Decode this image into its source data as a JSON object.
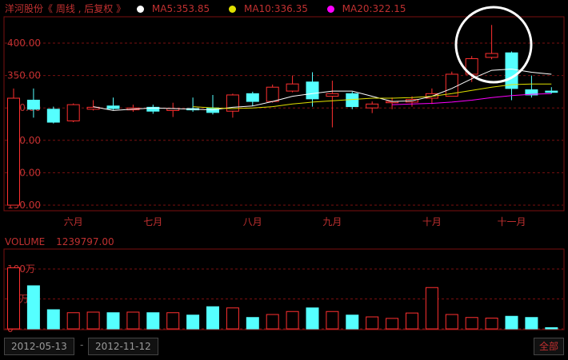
{
  "header": {
    "title": "洋河股份《 周线 , 后复权 》",
    "ma5_label": "MA5:353.85",
    "ma10_label": "MA10:336.35",
    "ma20_label": "MA20:322.15",
    "ma5_color": "#ffffff",
    "ma10_color": "#e0e000",
    "ma20_color": "#ff00ff"
  },
  "price_axis": {
    "labels": [
      "400.00",
      "350.00",
      "300.00",
      "250.00",
      "200.00",
      "150.00"
    ],
    "values": [
      400,
      350,
      300,
      250,
      200,
      150
    ]
  },
  "time_axis": {
    "labels": [
      "六月",
      "七月",
      "八月",
      "九月",
      "十月",
      "十一月"
    ]
  },
  "volume": {
    "label": "VOLUME",
    "value": "1239797.00",
    "axis_labels": [
      "100万",
      "50万",
      "0"
    ]
  },
  "colors": {
    "up": "#ff3030",
    "down": "#55ffff",
    "grid": "#7a1010"
  },
  "chart_data": {
    "type": "candlestick",
    "ylim": [
      150,
      420
    ],
    "candles": [
      {
        "open": 150,
        "close": 315,
        "high": 330,
        "low": 150,
        "volume": 1020000
      },
      {
        "open": 312,
        "close": 298,
        "high": 330,
        "low": 285,
        "volume": 720000
      },
      {
        "open": 298,
        "close": 278,
        "high": 302,
        "low": 276,
        "volume": 320000
      },
      {
        "open": 280,
        "close": 305,
        "high": 307,
        "low": 278,
        "volume": 270000
      },
      {
        "open": 298,
        "close": 301,
        "high": 312,
        "low": 296,
        "volume": 280000
      },
      {
        "open": 303,
        "close": 299,
        "high": 316,
        "low": 297,
        "volume": 270000
      },
      {
        "open": 297,
        "close": 300,
        "high": 305,
        "low": 294,
        "volume": 280000
      },
      {
        "open": 301,
        "close": 295,
        "high": 305,
        "low": 291,
        "volume": 270000
      },
      {
        "open": 296,
        "close": 299,
        "high": 308,
        "low": 286,
        "volume": 270000
      },
      {
        "open": 299,
        "close": 297,
        "high": 316,
        "low": 294,
        "volume": 230000
      },
      {
        "open": 300,
        "close": 293,
        "high": 320,
        "low": 290,
        "volume": 370000
      },
      {
        "open": 295,
        "close": 320,
        "high": 322,
        "low": 285,
        "volume": 350000
      },
      {
        "open": 322,
        "close": 310,
        "high": 325,
        "low": 303,
        "volume": 190000
      },
      {
        "open": 310,
        "close": 332,
        "high": 336,
        "low": 308,
        "volume": 240000
      },
      {
        "open": 326,
        "close": 337,
        "high": 350,
        "low": 324,
        "volume": 290000
      },
      {
        "open": 340,
        "close": 314,
        "high": 355,
        "low": 302,
        "volume": 350000
      },
      {
        "open": 318,
        "close": 322,
        "high": 342,
        "low": 270,
        "volume": 290000
      },
      {
        "open": 322,
        "close": 302,
        "high": 325,
        "low": 298,
        "volume": 230000
      },
      {
        "open": 300,
        "close": 306,
        "high": 310,
        "low": 292,
        "volume": 200000
      },
      {
        "open": 308,
        "close": 310,
        "high": 316,
        "low": 298,
        "volume": 175000
      },
      {
        "open": 309,
        "close": 313,
        "high": 318,
        "low": 302,
        "volume": 265000
      },
      {
        "open": 315,
        "close": 322,
        "high": 330,
        "low": 306,
        "volume": 690000
      },
      {
        "open": 318,
        "close": 352,
        "high": 356,
        "low": 318,
        "volume": 240000
      },
      {
        "open": 352,
        "close": 376,
        "high": 380,
        "low": 340,
        "volume": 190000
      },
      {
        "open": 378,
        "close": 384,
        "high": 428,
        "low": 375,
        "volume": 180000
      },
      {
        "open": 385,
        "close": 330,
        "high": 387,
        "low": 312,
        "volume": 210000
      },
      {
        "open": 328,
        "close": 320,
        "high": 350,
        "low": 316,
        "volume": 190000
      },
      {
        "open": 326,
        "close": 324,
        "high": 332,
        "low": 322,
        "volume": 20000
      }
    ],
    "ma5": [
      null,
      null,
      null,
      null,
      302,
      296,
      298,
      300,
      299,
      298,
      297,
      301,
      303,
      310,
      318,
      322,
      326,
      326,
      318,
      310,
      311,
      318,
      330,
      345,
      358,
      360,
      355,
      352
    ],
    "ma10": [
      null,
      null,
      null,
      null,
      null,
      null,
      null,
      null,
      null,
      302,
      300,
      299,
      300,
      302,
      306,
      309,
      311,
      313,
      315,
      315,
      316,
      318,
      322,
      327,
      332,
      336,
      337,
      337
    ],
    "ma20": [
      null,
      null,
      null,
      null,
      null,
      null,
      null,
      null,
      null,
      null,
      null,
      null,
      null,
      null,
      null,
      null,
      null,
      null,
      null,
      305,
      306,
      307,
      309,
      312,
      316,
      319,
      321,
      322
    ]
  },
  "footer": {
    "start_date": "2012-05-13",
    "end_date": "2012-11-12",
    "separator": "-",
    "all_label": "全部"
  }
}
